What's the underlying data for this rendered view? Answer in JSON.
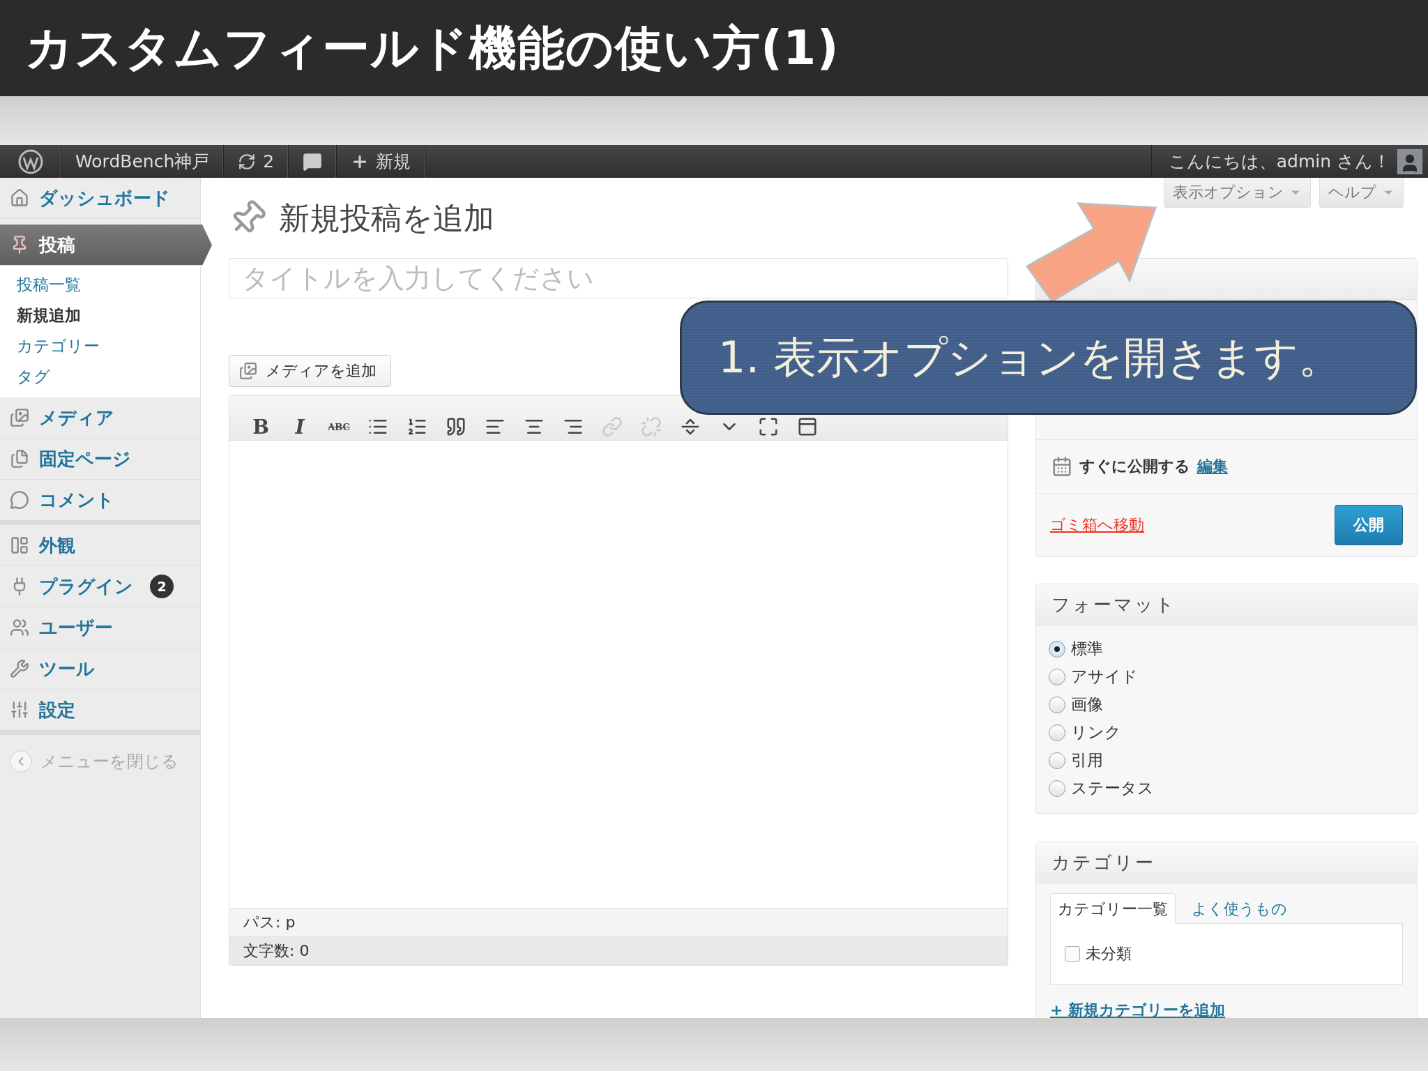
{
  "slide_title": "カスタムフィールド機能の使い方(1)",
  "admin_bar": {
    "site_name": "WordBench神戸",
    "updates_count": "2",
    "new_label": "新規",
    "greeting": "こんにちは、admin さん！"
  },
  "sidebar": {
    "groups": [
      {
        "items": [
          {
            "label": "ダッシュボード",
            "selected": false
          },
          {
            "label": "投稿",
            "selected": true,
            "children": [
              {
                "label": "投稿一覧",
                "selected": false
              },
              {
                "label": "新規追加",
                "selected": true
              },
              {
                "label": "カテゴリー",
                "selected": false
              },
              {
                "label": "タグ",
                "selected": false
              }
            ]
          },
          {
            "label": "メディア",
            "selected": false
          },
          {
            "label": "固定ページ",
            "selected": false
          },
          {
            "label": "コメント",
            "selected": false
          }
        ]
      },
      {
        "items": [
          {
            "label": "外観",
            "selected": false
          },
          {
            "label": "プラグイン",
            "selected": false,
            "badge": "2"
          },
          {
            "label": "ユーザー",
            "selected": false
          },
          {
            "label": "ツール",
            "selected": false
          },
          {
            "label": "設定",
            "selected": false
          }
        ]
      }
    ],
    "collapse_label": "メニューを閉じる"
  },
  "screen_meta": [
    {
      "label": "表示オプション"
    },
    {
      "label": "ヘルプ"
    }
  ],
  "heading": "新規投稿を追加",
  "title_field": {
    "placeholder": "タイトルを入力してください"
  },
  "media_button": "メディアを追加",
  "toolbar": {
    "text_buttons": [
      {
        "label": "B"
      },
      {
        "label": "I"
      },
      {
        "label": "ABC"
      }
    ],
    "icon_buttons": [
      {
        "disabled": false
      },
      {
        "disabled": false
      },
      {
        "disabled": false
      },
      {
        "disabled": false
      },
      {
        "disabled": false
      },
      {
        "disabled": false
      },
      {
        "disabled": true
      },
      {
        "disabled": true
      },
      {
        "disabled": false
      },
      {
        "disabled": false
      },
      {
        "disabled": false
      },
      {
        "disabled": false
      }
    ]
  },
  "editor_footer": {
    "path": "パス: p",
    "word_count": "文字数: 0"
  },
  "publish_box": {
    "schedule": "すぐに公開する",
    "schedule_link": "編集",
    "trash_link": "ゴミ箱へ移動",
    "publish_button": "公開"
  },
  "format_box": {
    "title": "フォーマット",
    "options": [
      {
        "label": "標準",
        "selected": true
      },
      {
        "label": "アサイド",
        "selected": false
      },
      {
        "label": "画像",
        "selected": false
      },
      {
        "label": "リンク",
        "selected": false
      },
      {
        "label": "引用",
        "selected": false
      },
      {
        "label": "ステータス",
        "selected": false
      }
    ]
  },
  "category_box": {
    "title": "カテゴリー",
    "tabs": [
      {
        "label": "カテゴリー一覧",
        "selected": true
      },
      {
        "label": "よく使うもの",
        "selected": false
      }
    ],
    "items": [
      {
        "label": "未分類",
        "checked": false
      }
    ],
    "add_link": "+ 新規カテゴリーを追加"
  },
  "callout": "1. 表示オプションを開きます。"
}
